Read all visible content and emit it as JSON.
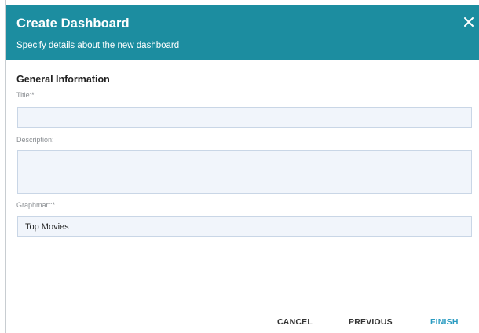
{
  "dialog": {
    "title": "Create Dashboard",
    "subtitle": "Specify details about the new dashboard",
    "close_icon": "close-icon"
  },
  "form": {
    "section_title": "General Information",
    "title_field": {
      "label": "Title:*",
      "value": "",
      "placeholder": ""
    },
    "description_field": {
      "label": "Description:",
      "value": "",
      "placeholder": ""
    },
    "graphmart_field": {
      "label": "Graphmart:*",
      "value": "Top Movies"
    }
  },
  "footer": {
    "cancel_label": "CANCEL",
    "previous_label": "PREVIOUS",
    "finish_label": "FINISH"
  },
  "colors": {
    "header_bg": "#1c8da0",
    "primary_action": "#2a9bc1",
    "field_bg": "#f1f5fb",
    "field_border": "#c9d6e6"
  }
}
